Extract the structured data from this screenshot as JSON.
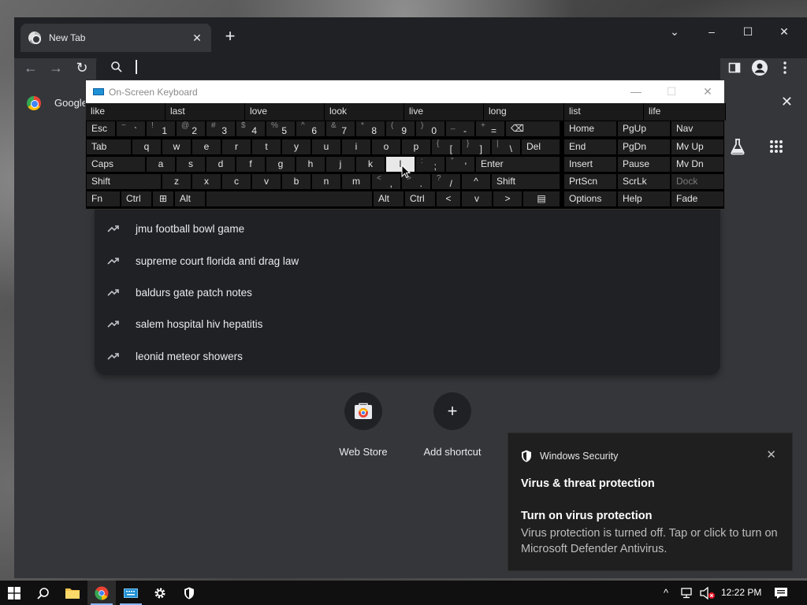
{
  "browser": {
    "tab_title": "New Tab",
    "tab_close": "✕",
    "new_tab": "+",
    "minimize": "–",
    "maximize": "☐",
    "close": "✕",
    "caret_down": "⌄",
    "back": "←",
    "forward": "→",
    "reload": "↻",
    "bookmark_label": "Google",
    "bookmark_close": "✕"
  },
  "suggestions": [
    "jmu football bowl game",
    "supreme court florida anti drag law",
    "baldurs gate patch notes",
    "salem hospital hiv hepatitis",
    "leonid meteor showers"
  ],
  "shortcuts": [
    {
      "label": "Web Store"
    },
    {
      "label": "Add shortcut",
      "glyph": "+"
    }
  ],
  "osk": {
    "title": "On-Screen Keyboard",
    "minimize": "—",
    "maximize": "☐",
    "close": "✕",
    "predictions": [
      "like",
      "last",
      "love",
      "look",
      "live",
      "long",
      "list",
      "life"
    ],
    "row1": [
      {
        "main": "Esc"
      },
      {
        "shift": "~",
        "low": "`"
      },
      {
        "shift": "!",
        "low": "1"
      },
      {
        "shift": "@",
        "low": "2"
      },
      {
        "shift": "#",
        "low": "3"
      },
      {
        "shift": "$",
        "low": "4"
      },
      {
        "shift": "%",
        "low": "5"
      },
      {
        "shift": "^",
        "low": "6"
      },
      {
        "shift": "&",
        "low": "7"
      },
      {
        "shift": "*",
        "low": "8"
      },
      {
        "shift": "(",
        "low": "9"
      },
      {
        "shift": ")",
        "low": "0"
      },
      {
        "shift": "_",
        "low": "-"
      },
      {
        "shift": "+",
        "low": "="
      },
      {
        "main": "⌫"
      }
    ],
    "row2": [
      {
        "main": "Tab"
      },
      {
        "main": "q"
      },
      {
        "main": "w"
      },
      {
        "main": "e"
      },
      {
        "main": "r"
      },
      {
        "main": "t"
      },
      {
        "main": "y"
      },
      {
        "main": "u"
      },
      {
        "main": "i"
      },
      {
        "main": "o"
      },
      {
        "main": "p"
      },
      {
        "shift": "{",
        "low": "["
      },
      {
        "shift": "}",
        "low": "]"
      },
      {
        "shift": "|",
        "low": "\\"
      },
      {
        "main": "Del"
      }
    ],
    "row3": [
      {
        "main": "Caps"
      },
      {
        "main": "a"
      },
      {
        "main": "s"
      },
      {
        "main": "d"
      },
      {
        "main": "f"
      },
      {
        "main": "g"
      },
      {
        "main": "h"
      },
      {
        "main": "j"
      },
      {
        "main": "k"
      },
      {
        "main": "l"
      },
      {
        "shift": ":",
        "low": ";"
      },
      {
        "shift": "\"",
        "low": "'"
      },
      {
        "main": "Enter"
      }
    ],
    "row4": [
      {
        "main": "Shift"
      },
      {
        "main": "z"
      },
      {
        "main": "x"
      },
      {
        "main": "c"
      },
      {
        "main": "v"
      },
      {
        "main": "b"
      },
      {
        "main": "n"
      },
      {
        "main": "m"
      },
      {
        "shift": "<",
        "low": ","
      },
      {
        "shift": ">",
        "low": "."
      },
      {
        "shift": "?",
        "low": "/"
      },
      {
        "main": "^"
      },
      {
        "main": "Shift"
      }
    ],
    "row5": [
      {
        "main": "Fn"
      },
      {
        "main": "Ctrl"
      },
      {
        "main": "⊞"
      },
      {
        "main": "Alt"
      },
      {
        "main": ""
      },
      {
        "main": "Alt"
      },
      {
        "main": "Ctrl"
      },
      {
        "main": "<"
      },
      {
        "main": "v"
      },
      {
        "main": ">"
      },
      {
        "main": "▤"
      }
    ],
    "nav": [
      [
        "Home",
        "PgUp",
        "Nav"
      ],
      [
        "End",
        "PgDn",
        "Mv Up"
      ],
      [
        "Insert",
        "Pause",
        "Mv Dn"
      ],
      [
        "PrtScn",
        "ScrLk",
        "Dock"
      ],
      [
        "Options",
        "Help",
        "Fade"
      ]
    ]
  },
  "toast": {
    "app": "Windows Security",
    "close": "✕",
    "heading": "Virus & threat protection",
    "subheading": "Turn on virus protection",
    "body": "Virus protection is turned off. Tap or click to turn on Microsoft Defender Antivirus."
  },
  "taskbar": {
    "start": "⊞",
    "search": "⌕",
    "time": "12:22 PM",
    "chevron": "^"
  },
  "colors": {
    "accent": "#8ab4f8",
    "chrome_dark": "#202124",
    "chrome_surface": "#35363a"
  }
}
